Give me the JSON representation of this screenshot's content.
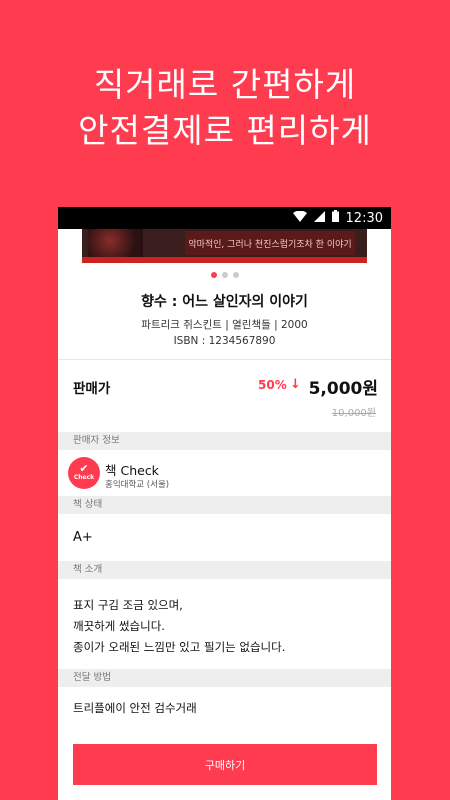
{
  "promo": {
    "line1": "직거래로 간편하게",
    "line2": "안전결제로 편리하게"
  },
  "statusbar": {
    "time": "12:30",
    "icons": [
      "wifi-icon",
      "signal-icon",
      "battery-icon"
    ]
  },
  "banner": {
    "text": "악마적인, 그러나 천진스럽기조차 한 이야기"
  },
  "carousel": {
    "count": 3,
    "active": 0
  },
  "book": {
    "title": "향수 : 어느 살인자의 이야기",
    "meta": "파트리크 쥐스킨트 | 열린책들 | 2000",
    "isbn": "ISBN : 1234567890"
  },
  "price": {
    "label": "판매가",
    "discount": "50%",
    "arrow": "↓",
    "current": "5,000원",
    "original": "10,000원"
  },
  "seller": {
    "header": "판매자 정보",
    "badge": "Check",
    "name": "책 Check",
    "school": "홍익대학교 (서울)"
  },
  "condition": {
    "header": "책 상태",
    "value": "A+"
  },
  "description": {
    "header": "책 소개",
    "line1": "표지 구김 조금 있으며,",
    "line2": "깨끗하게 썼습니다.",
    "line3": "종이가 오래된 느낌만 있고 필기는 없습니다."
  },
  "delivery": {
    "header": "전달 방법",
    "value": "트리플에이 안전 검수거래"
  },
  "buy_button": "구매하기",
  "colors": {
    "accent": "#ff3b50"
  }
}
